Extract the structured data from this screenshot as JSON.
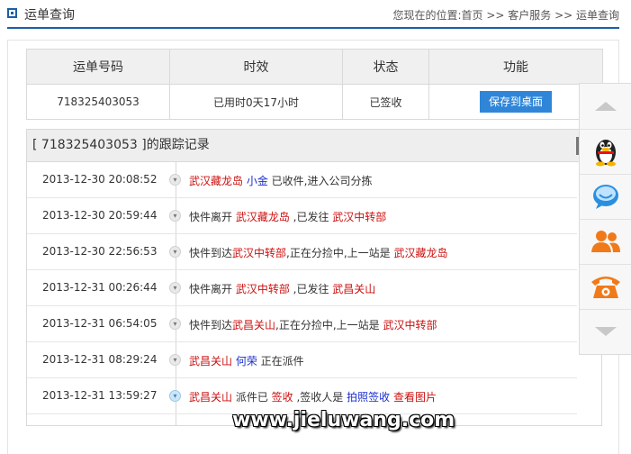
{
  "header": {
    "title": "运单查询",
    "breadcrumb": "您现在的位置:首页 >> 客户服务 >> 运单查询"
  },
  "summary": {
    "headers": [
      "运单号码",
      "时效",
      "状态",
      "功能"
    ],
    "tracking_number": "718325403053",
    "elapsed": "已用时0天17小时",
    "status": "已签收",
    "save_button": "保存到桌面"
  },
  "tracking": {
    "title": "[ 718325403053 ]的跟踪记录",
    "records": [
      {
        "time": "2013-12-30 20:08:52",
        "parts": [
          {
            "t": "武汉藏龙岛",
            "c": "red"
          },
          {
            "t": " "
          },
          {
            "t": "小金",
            "c": "blue"
          },
          {
            "t": " 已收件,进入公司分拣"
          }
        ]
      },
      {
        "time": "2013-12-30 20:59:44",
        "parts": [
          {
            "t": "快件离开 "
          },
          {
            "t": "武汉藏龙岛",
            "c": "red"
          },
          {
            "t": " ,已发往 "
          },
          {
            "t": "武汉中转部",
            "c": "red"
          }
        ]
      },
      {
        "time": "2013-12-30 22:56:53",
        "parts": [
          {
            "t": "快件到达"
          },
          {
            "t": "武汉中转部",
            "c": "red"
          },
          {
            "t": ",正在分捡中,上一站是 "
          },
          {
            "t": "武汉藏龙岛",
            "c": "red"
          }
        ]
      },
      {
        "time": "2013-12-31 00:26:44",
        "parts": [
          {
            "t": "快件离开 "
          },
          {
            "t": "武汉中转部",
            "c": "red"
          },
          {
            "t": " ,已发往 "
          },
          {
            "t": "武昌关山",
            "c": "red"
          }
        ]
      },
      {
        "time": "2013-12-31 06:54:05",
        "parts": [
          {
            "t": "快件到达"
          },
          {
            "t": "武昌关山",
            "c": "red"
          },
          {
            "t": ",正在分捡中,上一站是 "
          },
          {
            "t": "武汉中转部",
            "c": "red"
          }
        ]
      },
      {
        "time": "2013-12-31 08:29:24",
        "parts": [
          {
            "t": "武昌关山",
            "c": "red"
          },
          {
            "t": " "
          },
          {
            "t": "何荣",
            "c": "blue"
          },
          {
            "t": " 正在派件"
          }
        ]
      },
      {
        "time": "2013-12-31 13:59:27",
        "parts": [
          {
            "t": "武昌关山",
            "c": "red"
          },
          {
            "t": " 派件已 "
          },
          {
            "t": "签收",
            "c": "red"
          },
          {
            "t": " ,签收人是 "
          },
          {
            "t": "拍照签收",
            "c": "blue"
          },
          {
            "t": " "
          },
          {
            "t": "查看图片",
            "c": "red"
          }
        ]
      }
    ]
  },
  "sidebar": {
    "icons": [
      "arrow-up-icon",
      "qq-penguin-icon",
      "chat-bubble-icon",
      "users-icon",
      "telephone-icon",
      "arrow-down-icon"
    ]
  },
  "watermark": "www.jieluwang.com",
  "colors": {
    "accent": "#1b5fa7",
    "button": "#2f86d8",
    "highlight_red": "#cc1111",
    "highlight_blue": "#1a2ecc"
  }
}
